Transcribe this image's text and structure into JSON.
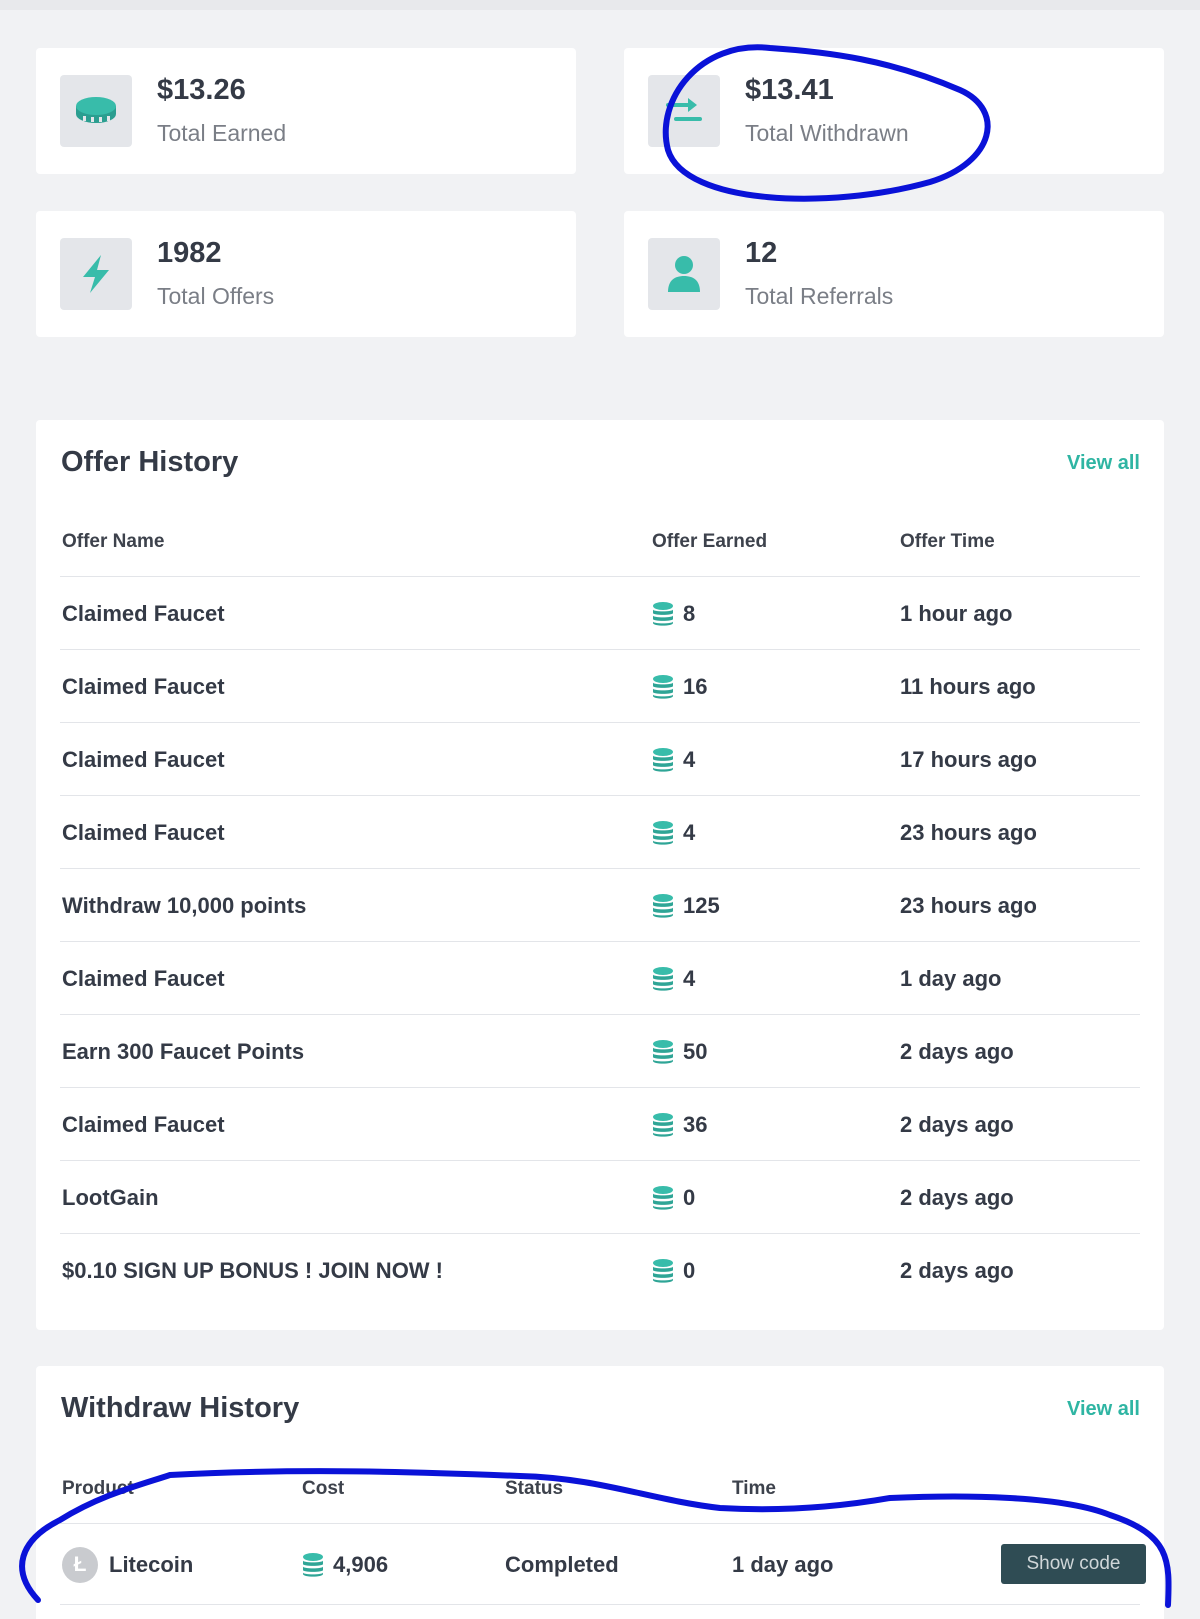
{
  "stats": [
    {
      "value": "$13.26",
      "label": "Total Earned",
      "icon": "coin-icon"
    },
    {
      "value": "$13.41",
      "label": "Total Withdrawn",
      "icon": "transfer-arrows-icon"
    },
    {
      "value": "1982",
      "label": "Total Offers",
      "icon": "lightning-bolt-icon"
    },
    {
      "value": "12",
      "label": "Total Referrals",
      "icon": "user-icon"
    }
  ],
  "offer_history": {
    "title": "Offer History",
    "view_all": "View all",
    "columns": [
      "Offer Name",
      "Offer Earned",
      "Offer Time"
    ],
    "rows": [
      {
        "name": "Claimed Faucet",
        "earned": "8",
        "time": "1 hour ago"
      },
      {
        "name": "Claimed Faucet",
        "earned": "16",
        "time": "11 hours ago"
      },
      {
        "name": "Claimed Faucet",
        "earned": "4",
        "time": "17 hours ago"
      },
      {
        "name": "Claimed Faucet",
        "earned": "4",
        "time": "23 hours ago"
      },
      {
        "name": "Withdraw 10,000 points",
        "earned": "125",
        "time": "23 hours ago"
      },
      {
        "name": "Claimed Faucet",
        "earned": "4",
        "time": "1 day ago"
      },
      {
        "name": "Earn 300 Faucet Points",
        "earned": "50",
        "time": "2 days ago"
      },
      {
        "name": "Claimed Faucet",
        "earned": "36",
        "time": "2 days ago"
      },
      {
        "name": "LootGain",
        "earned": "0",
        "time": "2 days ago"
      },
      {
        "name": "$0.10 SIGN UP BONUS ! JOIN NOW !",
        "earned": "0",
        "time": "2 days ago"
      }
    ]
  },
  "withdraw_history": {
    "title": "Withdraw History",
    "view_all": "View all",
    "columns": [
      "Product",
      "Cost",
      "Status",
      "Time"
    ],
    "rows": [
      {
        "product": "Litecoin",
        "cost": "4,906",
        "status": "Completed",
        "time": "1 day ago",
        "action": "Show code"
      }
    ]
  },
  "colors": {
    "accent": "#2fb5a3",
    "page_bg": "#f1f2f4",
    "button_bg": "#2f4c54",
    "annotation": "#0a12d8"
  }
}
